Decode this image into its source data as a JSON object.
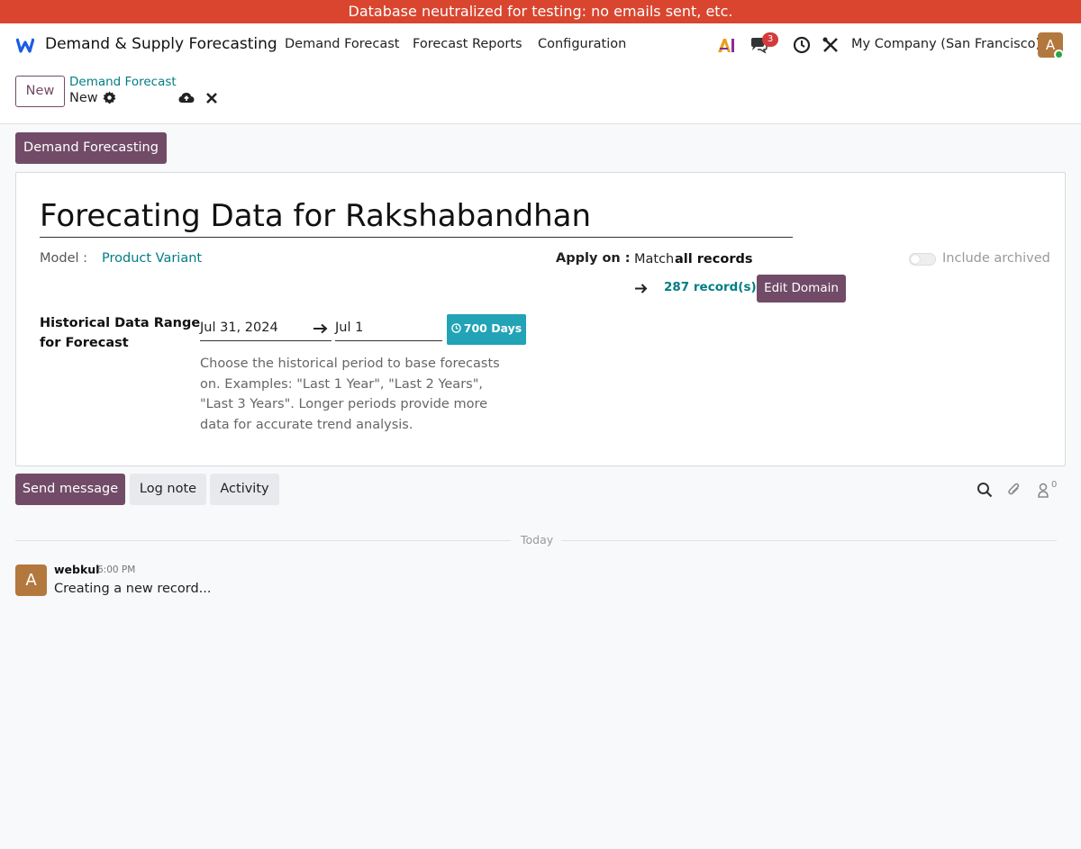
{
  "banner": {
    "text": "Database neutralized for testing: no emails sent, etc."
  },
  "navbar": {
    "logo_icon": "app-logo-icon",
    "app_name": "Demand & Supply Forecasting",
    "menus": [
      "Demand Forecast",
      "Forecast Reports",
      "Configuration"
    ],
    "messages_count": "3",
    "company": "My Company (San Francisco)",
    "user_initial": "A"
  },
  "control": {
    "new_label": "New",
    "breadcrumb_parent": "Demand Forecast",
    "breadcrumb_current": "New"
  },
  "statusbar": {
    "demand_button": "Demand Forecasting"
  },
  "form": {
    "title": "Forecating Data for Rakshabandhan",
    "model_label": "Model :",
    "model_value": "Product Variant",
    "apply_on_label": "Apply on :",
    "match_prefix": "Match",
    "match_bold": "all records",
    "records_link": "287 record(s)",
    "edit_domain": "Edit Domain",
    "include_archived": "Include archived",
    "include_archived_on": false,
    "history_label_line1": "Historical Data Range",
    "history_label_line2": "for Forecast",
    "date_from": "Jul 31, 2024",
    "date_to": "Jul 1",
    "days_badge": "700 Days",
    "help_text": "Choose the historical period to base forecasts on. Examples: \"Last 1 Year\", \"Last 2 Years\", \"Last 3 Years\". Longer periods provide more data for accurate trend analysis."
  },
  "chatter": {
    "send_message": "Send message",
    "log_note": "Log note",
    "activity": "Activity",
    "followers_count": "0",
    "separator_label": "Today",
    "message": {
      "avatar_initial": "A",
      "author": "webkul",
      "time": "6:00 PM",
      "body": "Creating a new record..."
    }
  },
  "colors": {
    "banner": "#d9452e",
    "primary": "#714b67",
    "link": "#017e84",
    "badge_teal": "#22a3b6"
  }
}
